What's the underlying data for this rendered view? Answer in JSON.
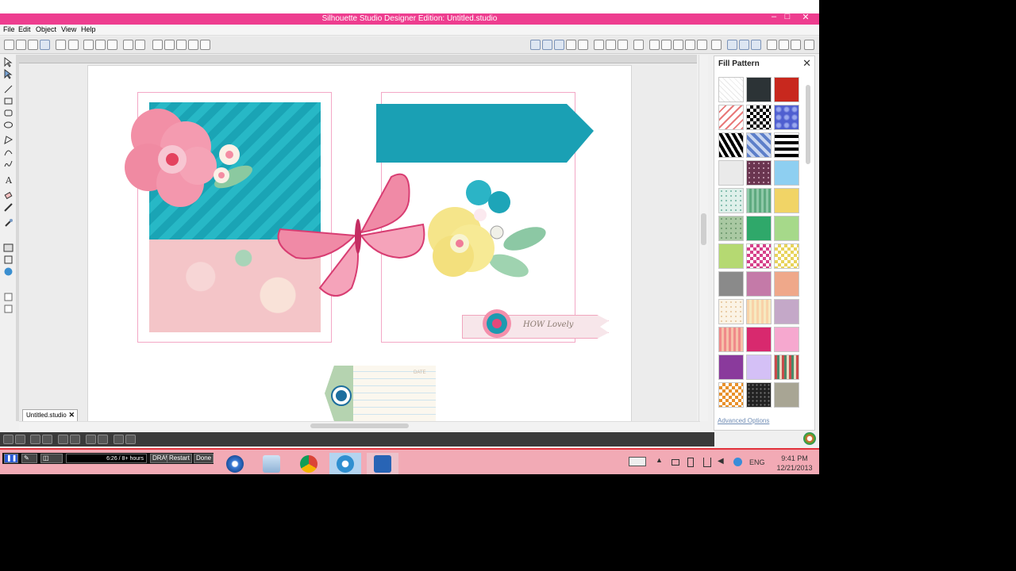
{
  "window": {
    "title": "Silhouette Studio Designer Edition: Untitled.studio",
    "controls": [
      "–",
      "□",
      "✕"
    ]
  },
  "menu": [
    "File",
    "Edit",
    "Object",
    "View",
    "Help"
  ],
  "document_tab": {
    "label": "Untitled.studio"
  },
  "canvas": {
    "label_text": "HOW Lovely",
    "tag_stamp_text": "DATE"
  },
  "fill_panel": {
    "title": "Fill Pattern",
    "close": "✕",
    "advanced_link": "Advanced Options",
    "swatch_names": [
      "plain-white",
      "dark-slate",
      "red-texture",
      "arrow-pattern",
      "checkerboard",
      "blue-paisley",
      "black-diamond",
      "blue-argyle",
      "black-stripes",
      "light-gray",
      "plum-dots",
      "sky-blue",
      "mint-dots",
      "green-stripes",
      "yellow-texture",
      "sage-dots",
      "kelly-green",
      "light-green",
      "lime",
      "magenta-harlequin",
      "yellow-harlequin",
      "gray",
      "mauve",
      "peach",
      "cream-dots",
      "peach-stripes",
      "lavender",
      "coral-stripes",
      "hot-pink",
      "pink",
      "purple",
      "light-lavender",
      "multi-stripes",
      "orange-harlequin",
      "black-dots",
      "taupe"
    ]
  },
  "recorder": {
    "time": "6:26 / 8+ hours",
    "restart": "Restart",
    "done": "Done",
    "draw": "DRAW"
  },
  "taskbar": {
    "apps": [
      "start-orb",
      "calculator",
      "chrome",
      "silhouette-studio",
      "screencast-o-matic"
    ],
    "lang": "ENG",
    "clock_time": "9:41 PM",
    "clock_date": "12/21/2013"
  }
}
